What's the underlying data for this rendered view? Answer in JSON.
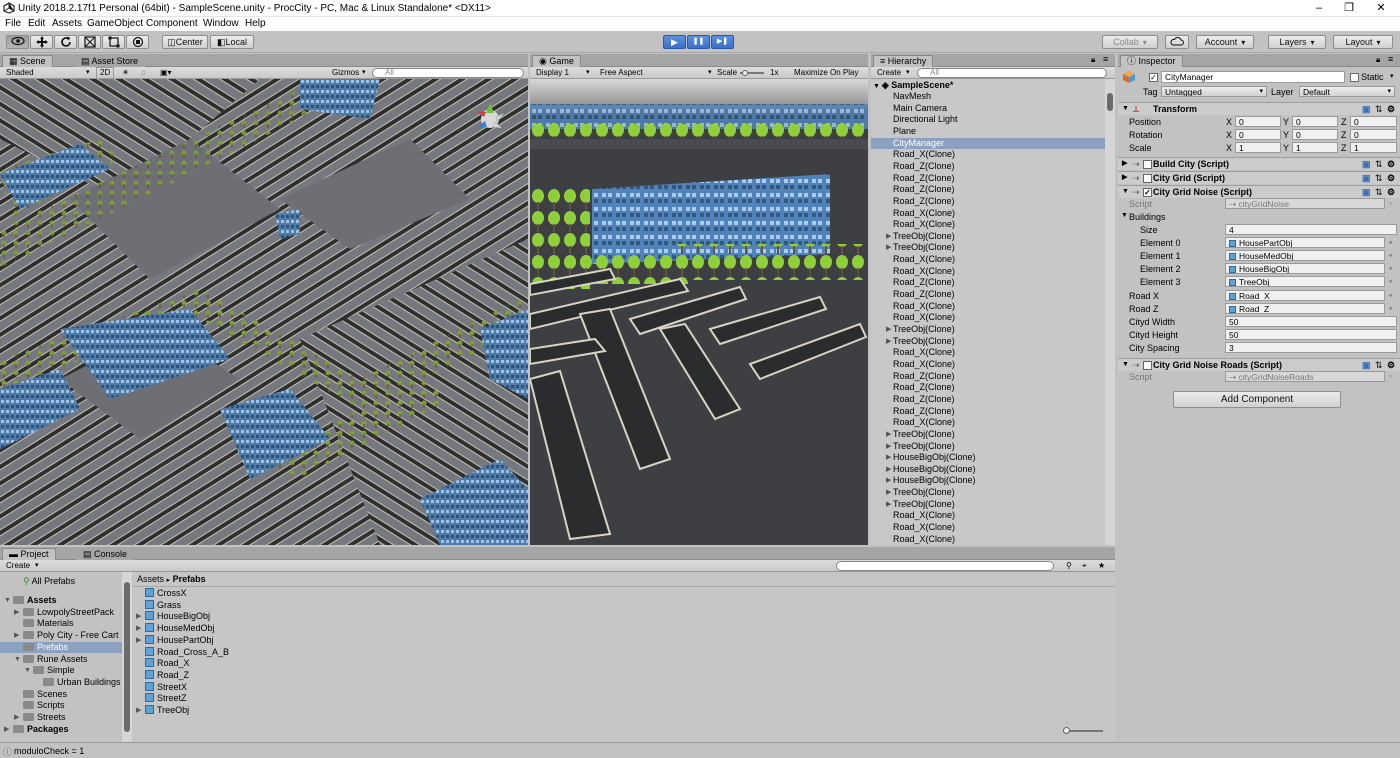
{
  "window": {
    "title": "Unity 2018.2.17f1 Personal (64bit) - SampleScene.unity - ProcCity - PC, Mac & Linux Standalone* <DX11>",
    "minimize": "–",
    "maximize": "❐",
    "close": "✕"
  },
  "menu": [
    "File",
    "Edit",
    "Assets",
    "GameObject",
    "Component",
    "Window",
    "Help"
  ],
  "toolbar": {
    "pivot": "Center",
    "space": "Local",
    "collab": "Collab",
    "account": "Account",
    "layers": "Layers",
    "layout": "Layout",
    "play_icon": "▶",
    "pause_icon": "❚❚",
    "step_icon": "▶❚"
  },
  "scene": {
    "tab": "Scene",
    "tab2": "Asset Store",
    "shading": "Shaded",
    "mode2d": "2D",
    "gizmos": "Gizmos",
    "search": "All",
    "persp": "≡Persp"
  },
  "game": {
    "tab": "Game",
    "display": "Display 1",
    "aspect": "Free Aspect",
    "scale_label": "Scale",
    "scale_value": "1x",
    "maximize": "Maximize On Play"
  },
  "hierarchy": {
    "tab": "Hierarchy",
    "create": "Create",
    "search": "All",
    "scene": "SampleScene*",
    "items": [
      {
        "label": "NavMesh",
        "fold": false
      },
      {
        "label": "Main Camera",
        "fold": false
      },
      {
        "label": "Directional Light",
        "fold": false
      },
      {
        "label": "Plane",
        "fold": false
      },
      {
        "label": "CityManager",
        "fold": false,
        "selected": true
      },
      {
        "label": "Road_X(Clone)",
        "fold": false
      },
      {
        "label": "Road_Z(Clone)",
        "fold": false
      },
      {
        "label": "Road_Z(Clone)",
        "fold": false
      },
      {
        "label": "Road_Z(Clone)",
        "fold": false
      },
      {
        "label": "Road_Z(Clone)",
        "fold": false
      },
      {
        "label": "Road_X(Clone)",
        "fold": false
      },
      {
        "label": "Road_X(Clone)",
        "fold": false
      },
      {
        "label": "TreeObj(Clone)",
        "fold": true
      },
      {
        "label": "TreeObj(Clone)",
        "fold": true
      },
      {
        "label": "Road_X(Clone)",
        "fold": false
      },
      {
        "label": "Road_X(Clone)",
        "fold": false
      },
      {
        "label": "Road_Z(Clone)",
        "fold": false
      },
      {
        "label": "Road_Z(Clone)",
        "fold": false
      },
      {
        "label": "Road_X(Clone)",
        "fold": false
      },
      {
        "label": "Road_X(Clone)",
        "fold": false
      },
      {
        "label": "TreeObj(Clone)",
        "fold": true
      },
      {
        "label": "TreeObj(Clone)",
        "fold": true
      },
      {
        "label": "Road_X(Clone)",
        "fold": false
      },
      {
        "label": "Road_X(Clone)",
        "fold": false
      },
      {
        "label": "Road_Z(Clone)",
        "fold": false
      },
      {
        "label": "Road_Z(Clone)",
        "fold": false
      },
      {
        "label": "Road_Z(Clone)",
        "fold": false
      },
      {
        "label": "Road_Z(Clone)",
        "fold": false
      },
      {
        "label": "Road_X(Clone)",
        "fold": false
      },
      {
        "label": "TreeObj(Clone)",
        "fold": true
      },
      {
        "label": "TreeObj(Clone)",
        "fold": true
      },
      {
        "label": "HouseBigObj(Clone)",
        "fold": true
      },
      {
        "label": "HouseBigObj(Clone)",
        "fold": true
      },
      {
        "label": "HouseBigObj(Clone)",
        "fold": true
      },
      {
        "label": "TreeObj(Clone)",
        "fold": true
      },
      {
        "label": "TreeObj(Clone)",
        "fold": true
      },
      {
        "label": "Road_X(Clone)",
        "fold": false
      },
      {
        "label": "Road_X(Clone)",
        "fold": false
      },
      {
        "label": "Road_X(Clone)",
        "fold": false
      }
    ]
  },
  "inspector": {
    "tab": "Inspector",
    "object_name": "CityManager",
    "static": "Static",
    "tag_label": "Tag",
    "tag_value": "Untagged",
    "layer_label": "Layer",
    "layer_value": "Default",
    "transform": {
      "title": "Transform",
      "rows": [
        {
          "label": "Position",
          "x": "0",
          "y": "0",
          "z": "0"
        },
        {
          "label": "Rotation",
          "x": "0",
          "y": "0",
          "z": "0"
        },
        {
          "label": "Scale",
          "x": "1",
          "y": "1",
          "z": "1"
        }
      ]
    },
    "comp_build_city": "Build City (Script)",
    "comp_city_grid": "City Grid (Script)",
    "comp_noise": "City Grid Noise (Script)",
    "script_label": "Script",
    "noise_script": "cityGridNoise",
    "buildings_label": "Buildings",
    "size_label": "Size",
    "size_value": "4",
    "elements": [
      {
        "label": "Element 0",
        "value": "HousePartObj"
      },
      {
        "label": "Element 1",
        "value": "HouseMedObj"
      },
      {
        "label": "Element 2",
        "value": "HouseBigObj"
      },
      {
        "label": "Element 3",
        "value": "TreeObj"
      }
    ],
    "road_x_label": "Road X",
    "road_x_value": "Road_X",
    "road_z_label": "Road Z",
    "road_z_value": "Road_Z",
    "width_label": "Cityd Width",
    "width_value": "50",
    "height_label": "Cityd Height",
    "height_value": "50",
    "spacing_label": "City Spacing",
    "spacing_value": "3",
    "comp_noise_roads": "City Grid Noise Roads (Script)",
    "noise_roads_script": "cityGridNoiseRoads",
    "add_component": "Add Component",
    "axis_x": "X",
    "axis_y": "Y",
    "axis_z": "Z"
  },
  "project": {
    "tab": "Project",
    "tab2": "Console",
    "create": "Create",
    "tree": [
      {
        "label": "All Prefabs",
        "indent": 1,
        "kind": "search"
      },
      {
        "label": "Assets",
        "indent": 0,
        "kind": "folder",
        "bold": true,
        "open": true
      },
      {
        "label": "LowpolyStreetPack",
        "indent": 1,
        "kind": "folder",
        "fold": true
      },
      {
        "label": "Materials",
        "indent": 1,
        "kind": "folder"
      },
      {
        "label": "Poly City - Free Cart",
        "indent": 1,
        "kind": "folder",
        "fold": true
      },
      {
        "label": "Prefabs",
        "indent": 1,
        "kind": "folder",
        "selected": true
      },
      {
        "label": "Rune Assets",
        "indent": 1,
        "kind": "folder",
        "open": true
      },
      {
        "label": "Simple",
        "indent": 2,
        "kind": "folder",
        "open": true
      },
      {
        "label": "Urban Buildings",
        "indent": 3,
        "kind": "folder"
      },
      {
        "label": "Scenes",
        "indent": 1,
        "kind": "folder"
      },
      {
        "label": "Scripts",
        "indent": 1,
        "kind": "folder"
      },
      {
        "label": "Streets",
        "indent": 1,
        "kind": "folder",
        "fold": true
      },
      {
        "label": "Packages",
        "indent": 0,
        "kind": "folder",
        "bold": true,
        "fold": true
      }
    ],
    "breadcrumb_root": "Assets",
    "breadcrumb_sep": "▸",
    "breadcrumb_current": "Prefabs",
    "assets": [
      {
        "label": "CrossX",
        "fold": false
      },
      {
        "label": "Grass",
        "fold": false
      },
      {
        "label": "HouseBigObj",
        "fold": true
      },
      {
        "label": "HouseMedObj",
        "fold": true
      },
      {
        "label": "HousePartObj",
        "fold": true
      },
      {
        "label": "Road_Cross_A_B",
        "fold": false
      },
      {
        "label": "Road_X",
        "fold": false
      },
      {
        "label": "Road_Z",
        "fold": false
      },
      {
        "label": "StreetX",
        "fold": false
      },
      {
        "label": "StreetZ",
        "fold": false
      },
      {
        "label": "TreeObj",
        "fold": true
      }
    ]
  },
  "status": "moduloCheck = 1"
}
